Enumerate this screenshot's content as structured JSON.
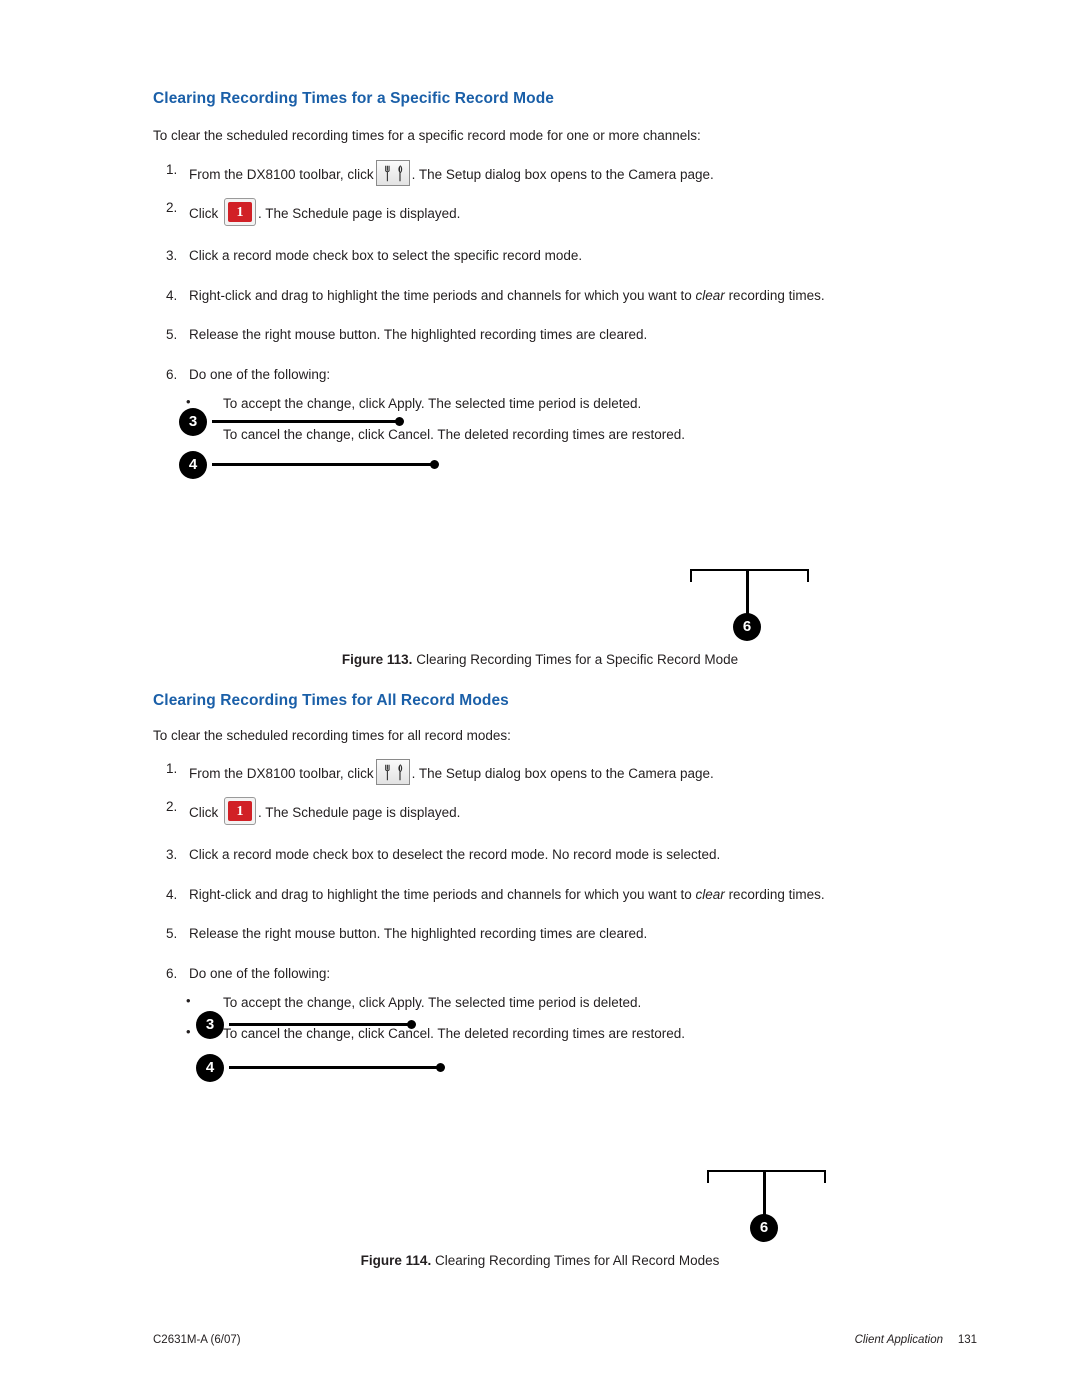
{
  "section1": {
    "title": "Clearing Recording Times for a Specific Record Mode",
    "intro": "To clear the scheduled recording times for a specific record mode for one or more channels:",
    "steps": [
      {
        "num": "1.",
        "pre": "From the DX8100 toolbar, click",
        "icon": "toolbar-icon",
        "post": ". The Setup dialog box opens to the Camera page."
      },
      {
        "num": "2.",
        "pre": "Click",
        "icon": "schedule-icon",
        "post": ". The Schedule page is displayed."
      },
      {
        "num": "3.",
        "pre": "Click a record mode check box to select the specific record mode.",
        "icon": "",
        "post": ""
      },
      {
        "num": "4.",
        "pre": "Right-click and drag to highlight the time periods and channels for which you want to ",
        "em": "clear",
        "post": " recording times."
      },
      {
        "num": "5.",
        "pre": "Release the right mouse button. The highlighted recording times are cleared.",
        "icon": "",
        "post": ""
      },
      {
        "num": "6.",
        "pre": "Do one of the following:",
        "icon": "",
        "post": ""
      }
    ],
    "sublist": [
      "To accept the change, click Apply. The selected time period is deleted.",
      "To cancel the change, click Cancel. The deleted recording times are restored."
    ],
    "callouts": {
      "a": "3",
      "b": "4",
      "c": "6"
    },
    "figure_label": "Figure 113.",
    "figure_caption": "Clearing Recording Times for a Specific Record Mode"
  },
  "section2": {
    "title": "Clearing Recording Times for All Record Modes",
    "intro": "To clear the scheduled recording times for all record modes:",
    "steps": [
      {
        "num": "1.",
        "pre": "From the DX8100 toolbar, click",
        "icon": "toolbar-icon",
        "post": ". The Setup dialog box opens to the Camera page."
      },
      {
        "num": "2.",
        "pre": "Click",
        "icon": "schedule-icon",
        "post": ". The Schedule page is displayed."
      },
      {
        "num": "3.",
        "pre": "Click a record mode check box to deselect the record mode. No record mode is selected.",
        "icon": "",
        "post": ""
      },
      {
        "num": "4.",
        "pre": "Right-click and drag to highlight the time periods and channels for which you want to ",
        "em": "clear",
        "post": " recording times."
      },
      {
        "num": "5.",
        "pre": "Release the right mouse button. The highlighted recording times are cleared.",
        "icon": "",
        "post": ""
      },
      {
        "num": "6.",
        "pre": "Do one of the following:",
        "icon": "",
        "post": ""
      }
    ],
    "sublist": [
      "To accept the change, click Apply. The selected time period is deleted.",
      "To cancel the change, click Cancel. The deleted recording times are restored."
    ],
    "callouts": {
      "a": "3",
      "b": "4",
      "c": "6"
    },
    "figure_label": "Figure 114.",
    "figure_caption": "Clearing Recording Times for All Record Modes"
  },
  "footer": {
    "doc_id": "C2631M-A (6/07)",
    "section": "Client Application",
    "page": "131"
  },
  "colors": {
    "heading": "#1a5fa8",
    "text": "#231f20",
    "callout": "#000000",
    "icon_red": "#d12026"
  }
}
